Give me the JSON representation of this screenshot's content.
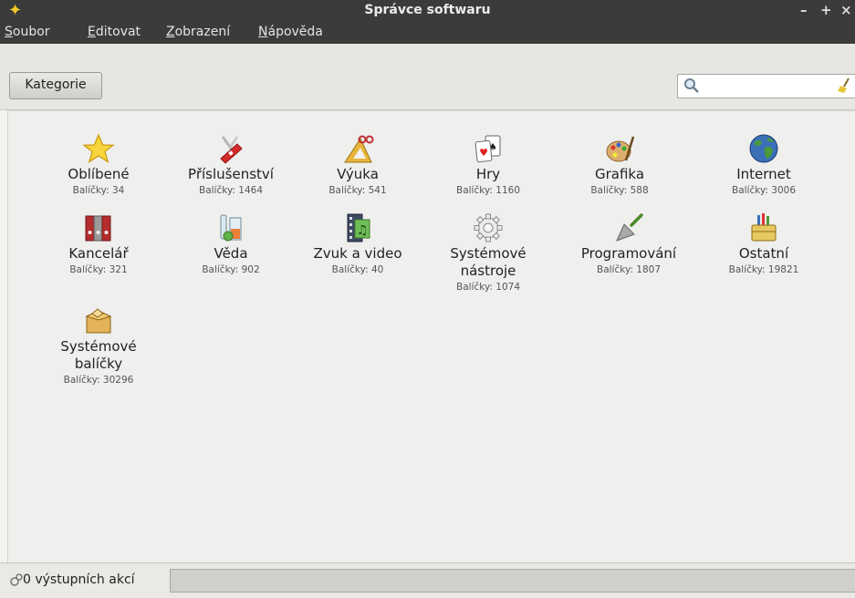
{
  "window": {
    "title": "Správce softwaru"
  },
  "menu": [
    {
      "accel": "S",
      "rest": "oubor"
    },
    {
      "accel": "E",
      "rest": "ditovat"
    },
    {
      "accel": "Z",
      "rest": "obrazení"
    },
    {
      "accel": "N",
      "rest": "ápověda"
    }
  ],
  "toolbar": {
    "kategorie_label": "Kategorie"
  },
  "search": {
    "value": ""
  },
  "categories": [
    {
      "name": "Oblíbené",
      "count": "Balíčky: 34",
      "icon": "star-icon"
    },
    {
      "name": "Příslušenství",
      "count": "Balíčky: 1464",
      "icon": "swiss-knife-icon"
    },
    {
      "name": "Výuka",
      "count": "Balíčky: 541",
      "icon": "ruler-triangle-icon"
    },
    {
      "name": "Hry",
      "count": "Balíčky: 1160",
      "icon": "playing-cards-icon"
    },
    {
      "name": "Grafika",
      "count": "Balíčky: 588",
      "icon": "paint-palette-icon"
    },
    {
      "name": "Internet",
      "count": "Balíčky: 3006",
      "icon": "globe-icon"
    },
    {
      "name": "Kancelář",
      "count": "Balíčky: 321",
      "icon": "binders-icon"
    },
    {
      "name": "Věda",
      "count": "Balíčky: 902",
      "icon": "beaker-icon"
    },
    {
      "name": "Zvuk a video",
      "count": "Balíčky: 40",
      "icon": "film-music-icon"
    },
    {
      "name_l1": "Systémové",
      "name_l2": "nástroje",
      "count": "Balíčky: 1074",
      "icon": "gear-icon"
    },
    {
      "name": "Programování",
      "count": "Balíčky: 1807",
      "icon": "trowel-icon"
    },
    {
      "name": "Ostatní",
      "count": "Balíčky: 19821",
      "icon": "toolbox-icon"
    },
    {
      "name_l1": "Systémové",
      "name_l2": "balíčky",
      "count": "Balíčky: 30296",
      "icon": "package-box-icon"
    }
  ],
  "status": {
    "text": "0 výstupních akcí",
    "icon": "gears-icon"
  },
  "colors": {
    "titlebar": "#3b3b3b",
    "star": "#f4c92a"
  }
}
